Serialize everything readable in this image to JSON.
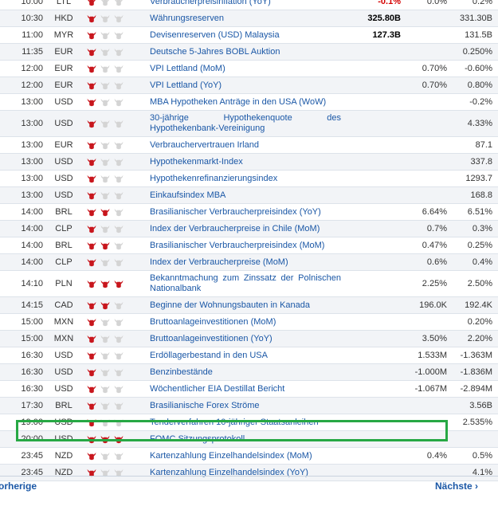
{
  "rows": [
    {
      "time": "10:00",
      "currency": "LTL",
      "importance": 1,
      "event": "Verbraucherpreisinflation (YoY)",
      "actual": "-0.1%",
      "actual_negative": true,
      "forecast": "0.0%",
      "previous": "0.2%"
    },
    {
      "time": "10:30",
      "currency": "HKD",
      "importance": 1,
      "event": "Währungsreserven",
      "actual": "325.80B",
      "forecast": "",
      "previous": "331.30B"
    },
    {
      "time": "11:00",
      "currency": "MYR",
      "importance": 1,
      "event": "Devisenreserven (USD) Malaysia",
      "actual": "127.3B",
      "forecast": "",
      "previous": "131.5B"
    },
    {
      "time": "11:35",
      "currency": "EUR",
      "importance": 1,
      "event": "Deutsche 5-Jahres BOBL Auktion",
      "actual": "",
      "forecast": "",
      "previous": "0.250%"
    },
    {
      "time": "12:00",
      "currency": "EUR",
      "importance": 1,
      "event": "VPI Lettland (MoM)",
      "actual": "",
      "forecast": "0.70%",
      "previous": "-0.60%"
    },
    {
      "time": "12:00",
      "currency": "EUR",
      "importance": 1,
      "event": "VPI Lettland (YoY)",
      "actual": "",
      "forecast": "0.70%",
      "previous": "0.80%"
    },
    {
      "time": "13:00",
      "currency": "USD",
      "importance": 1,
      "event": "MBA Hypotheken Anträge in den USA (WoW)",
      "actual": "",
      "forecast": "",
      "previous": "-0.2%"
    },
    {
      "time": "13:00",
      "currency": "USD",
      "importance": 1,
      "event": "30-jährige Hypothekenquote des Hypothekenbank-Vereinigung",
      "actual": "",
      "forecast": "",
      "previous": "4.33%",
      "tall": true
    },
    {
      "time": "13:00",
      "currency": "EUR",
      "importance": 1,
      "event": "Verbrauchervertrauen Irland",
      "actual": "",
      "forecast": "",
      "previous": "87.1"
    },
    {
      "time": "13:00",
      "currency": "USD",
      "importance": 1,
      "event": "Hypothekenmarkt-Index",
      "actual": "",
      "forecast": "",
      "previous": "337.8"
    },
    {
      "time": "13:00",
      "currency": "USD",
      "importance": 1,
      "event": "Hypothekenrefinanzierungsindex",
      "actual": "",
      "forecast": "",
      "previous": "1293.7"
    },
    {
      "time": "13:00",
      "currency": "USD",
      "importance": 1,
      "event": "Einkaufsindex MBA",
      "actual": "",
      "forecast": "",
      "previous": "168.8"
    },
    {
      "time": "14:00",
      "currency": "BRL",
      "importance": 2,
      "event": "Brasilianischer Verbraucherpreisindex (YoY)",
      "actual": "",
      "forecast": "6.64%",
      "previous": "6.51%"
    },
    {
      "time": "14:00",
      "currency": "CLP",
      "importance": 1,
      "event": "Index der Verbraucherpreise in Chile (MoM)",
      "actual": "",
      "forecast": "0.7%",
      "previous": "0.3%"
    },
    {
      "time": "14:00",
      "currency": "BRL",
      "importance": 2,
      "event": "Brasilianischer Verbraucherpreisindex (MoM)",
      "actual": "",
      "forecast": "0.47%",
      "previous": "0.25%"
    },
    {
      "time": "14:00",
      "currency": "CLP",
      "importance": 1,
      "event": "Index der Verbraucherpreise (MoM)",
      "actual": "",
      "forecast": "0.6%",
      "previous": "0.4%"
    },
    {
      "time": "14:10",
      "currency": "PLN",
      "importance": 3,
      "event": "Bekanntmachung zum Zinssatz der Polnischen Nationalbank",
      "actual": "",
      "forecast": "2.25%",
      "previous": "2.50%",
      "tall": true
    },
    {
      "time": "14:15",
      "currency": "CAD",
      "importance": 2,
      "event": "Beginne der Wohnungsbauten in Kanada",
      "actual": "",
      "forecast": "196.0K",
      "previous": "192.4K"
    },
    {
      "time": "15:00",
      "currency": "MXN",
      "importance": 1,
      "event": "Bruttoanlageinvestitionen (MoM)",
      "actual": "",
      "forecast": "",
      "previous": "0.20%"
    },
    {
      "time": "15:00",
      "currency": "MXN",
      "importance": 1,
      "event": "Bruttoanlageinvestitionen (YoY)",
      "actual": "",
      "forecast": "3.50%",
      "previous": "2.20%"
    },
    {
      "time": "16:30",
      "currency": "USD",
      "importance": 1,
      "event": "Erdöllagerbestand in den USA",
      "actual": "",
      "forecast": "1.533M",
      "previous": "-1.363M"
    },
    {
      "time": "16:30",
      "currency": "USD",
      "importance": 1,
      "event": "Benzinbestände",
      "actual": "",
      "forecast": "-1.000M",
      "previous": "-1.836M"
    },
    {
      "time": "16:30",
      "currency": "USD",
      "importance": 1,
      "event": "Wöchentlicher EIA Destillat Bericht",
      "actual": "",
      "forecast": "-1.067M",
      "previous": "-2.894M"
    },
    {
      "time": "17:30",
      "currency": "BRL",
      "importance": 1,
      "event": "Brasilianische Forex Ströme",
      "actual": "",
      "forecast": "",
      "previous": "3.56B"
    },
    {
      "time": "19:00",
      "currency": "USD",
      "importance": 1,
      "event": "Tenderverfahren 10-jähriger Staatsanleihen",
      "actual": "",
      "forecast": "",
      "previous": "2.535%"
    },
    {
      "time": "20:00",
      "currency": "USD",
      "importance": 3,
      "event": "FOMC Sitzungsprotokoll",
      "actual": "",
      "forecast": "",
      "previous": ""
    },
    {
      "time": "23:45",
      "currency": "NZD",
      "importance": 1,
      "event": "Kartenzahlung Einzelhandelsindex (MoM)",
      "actual": "",
      "forecast": "0.4%",
      "previous": "0.5%"
    },
    {
      "time": "23:45",
      "currency": "NZD",
      "importance": 1,
      "event": "Kartenzahlung Einzelhandelsindex (YoY)",
      "actual": "",
      "forecast": "",
      "previous": "4.1%"
    }
  ],
  "footer": {
    "prev_label": "orherige",
    "next_label": "Nächste",
    "next_arrow": "›"
  },
  "colors": {
    "bull_active": "#c8161d",
    "bull_inactive": "#d4d4d4",
    "link": "#1a57a6",
    "negative": "#d40000",
    "highlight": "#27a844"
  },
  "icons": {
    "importance": "bull-icon",
    "info": "plus-circle-icon"
  }
}
